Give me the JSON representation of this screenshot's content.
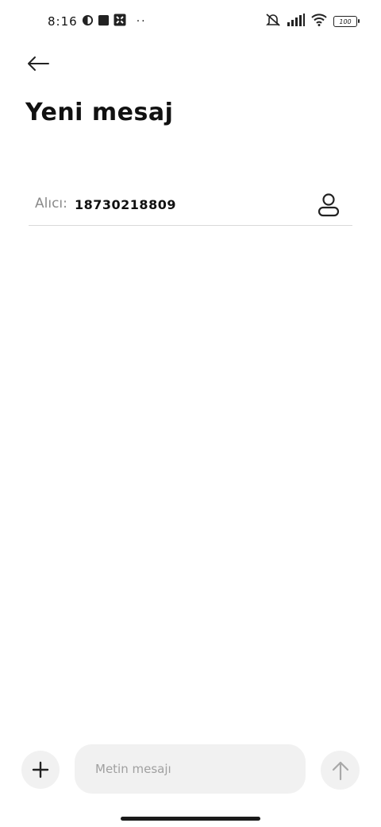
{
  "status_bar": {
    "time": "8:16",
    "left_icons": [
      "data-saver-icon",
      "square-app-icon",
      "shuffle-app-icon"
    ],
    "overflow": "··",
    "right_icons": [
      "muted-bell-icon",
      "signal-icon",
      "wifi-icon",
      "battery-icon"
    ],
    "battery_level": "100"
  },
  "header": {
    "back_icon": "arrow-left-icon",
    "title": "Yeni mesaj"
  },
  "recipient": {
    "label": "Alıcı:",
    "value": "18730218809",
    "contact_icon": "person-icon"
  },
  "compose": {
    "add_icon": "plus-icon",
    "placeholder": "Metin mesajı",
    "value": "",
    "send_icon": "arrow-up-icon"
  },
  "colors": {
    "background": "#ffffff",
    "field_background": "#f1f1f1",
    "divider": "#d9d9d9",
    "muted_text": "#8a8a8a"
  }
}
